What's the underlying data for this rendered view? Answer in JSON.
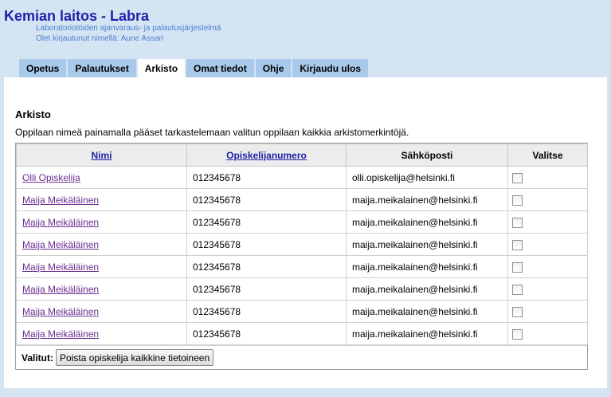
{
  "header": {
    "title": "Kemian laitos - Labra",
    "subtitle": "Laboratoriotöiden ajanvaraus- ja palautusjärjestelmä",
    "logged_in": "Olet kirjautunut nimellä: Aune Assari"
  },
  "tabs": [
    {
      "label": "Opetus",
      "active": false
    },
    {
      "label": "Palautukset",
      "active": false
    },
    {
      "label": "Arkisto",
      "active": true
    },
    {
      "label": "Omat tiedot",
      "active": false
    },
    {
      "label": "Ohje",
      "active": false
    },
    {
      "label": "Kirjaudu ulos",
      "active": false
    }
  ],
  "main": {
    "section_title": "Arkisto",
    "description": "Oppilaan nimeä painamalla pääset tarkastelemaan valitun oppilaan kaikkia arkistomerkintöjä.",
    "columns": [
      "Nimi",
      "Opiskelijanumero",
      "Sähköposti",
      "Valitse"
    ],
    "rows": [
      {
        "name": "Olli Opiskelija",
        "student_number": "012345678",
        "email": "olli.opiskelija@helsinki.fi",
        "selected": false
      },
      {
        "name": "Maija Meikäläinen",
        "student_number": "012345678",
        "email": "maija.meikalainen@helsinki.fi",
        "selected": false
      },
      {
        "name": "Maija Meikäläinen",
        "student_number": "012345678",
        "email": "maija.meikalainen@helsinki.fi",
        "selected": false
      },
      {
        "name": "Maija Meikäläinen",
        "student_number": "012345678",
        "email": "maija.meikalainen@helsinki.fi",
        "selected": false
      },
      {
        "name": "Maija Meikäläinen",
        "student_number": "012345678",
        "email": "maija.meikalainen@helsinki.fi",
        "selected": false
      },
      {
        "name": "Maija Meikäläinen",
        "student_number": "012345678",
        "email": "maija.meikalainen@helsinki.fi",
        "selected": false
      },
      {
        "name": "Maija Meikäläinen",
        "student_number": "012345678",
        "email": "maija.meikalainen@helsinki.fi",
        "selected": false
      },
      {
        "name": "Maija Meikäläinen",
        "student_number": "012345678",
        "email": "maija.meikalainen@helsinki.fi",
        "selected": false
      }
    ],
    "footer_label": "Valitut:",
    "delete_button_label": "Poista opiskelija kaikkine tietoineen"
  }
}
